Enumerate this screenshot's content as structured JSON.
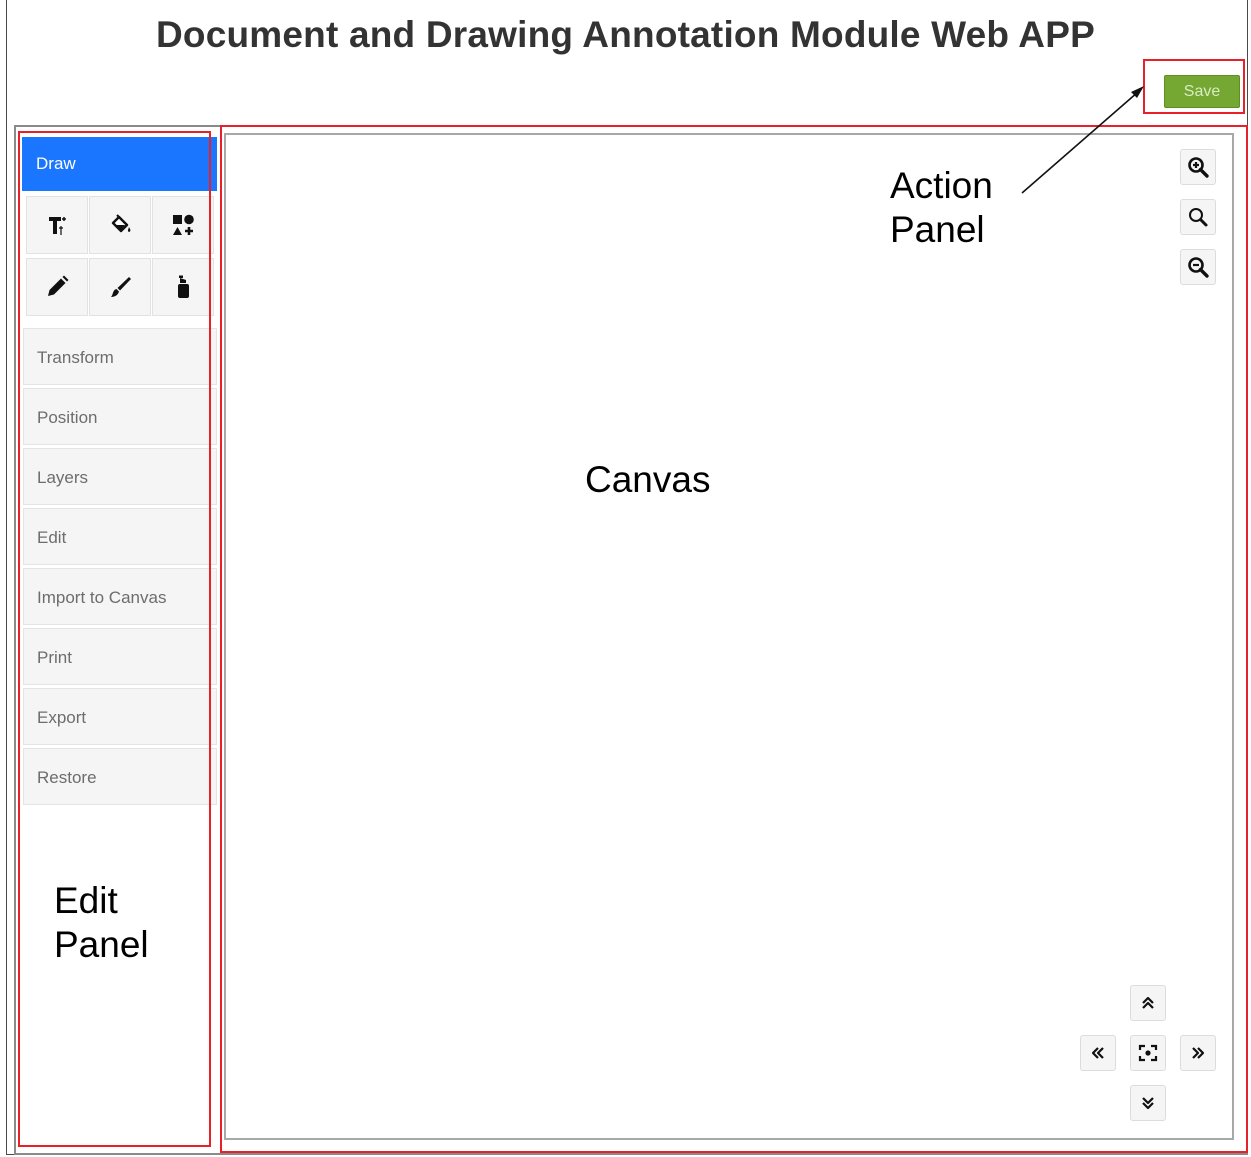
{
  "app": {
    "title": "Document and Drawing Annotation Module Web APP"
  },
  "action_panel": {
    "save_label": "Save"
  },
  "edit_panel": {
    "active_tab": "Draw",
    "tools": [
      {
        "icon": "text-icon"
      },
      {
        "icon": "fill-bucket-icon"
      },
      {
        "icon": "shapes-icon"
      },
      {
        "icon": "pencil-icon"
      },
      {
        "icon": "brush-icon"
      },
      {
        "icon": "spray-icon"
      }
    ],
    "menu": [
      "Transform",
      "Position",
      "Layers",
      "Edit",
      "Import to Canvas",
      "Print",
      "Export",
      "Restore"
    ]
  },
  "annotations": {
    "action_panel_line1": "Action",
    "action_panel_line2": "Panel",
    "canvas": "Canvas",
    "edit_panel_line1": "Edit",
    "edit_panel_line2": "Panel"
  },
  "zoom_controls": [
    "zoom-in-icon",
    "zoom-reset-icon",
    "zoom-out-icon"
  ],
  "pan_controls": [
    "pan-up-icon",
    "pan-left-icon",
    "pan-center-icon",
    "pan-right-icon",
    "pan-down-icon"
  ],
  "colors": {
    "accent_blue": "#1a75ff",
    "save_green": "#74a832",
    "highlight_red": "#e8202a"
  }
}
